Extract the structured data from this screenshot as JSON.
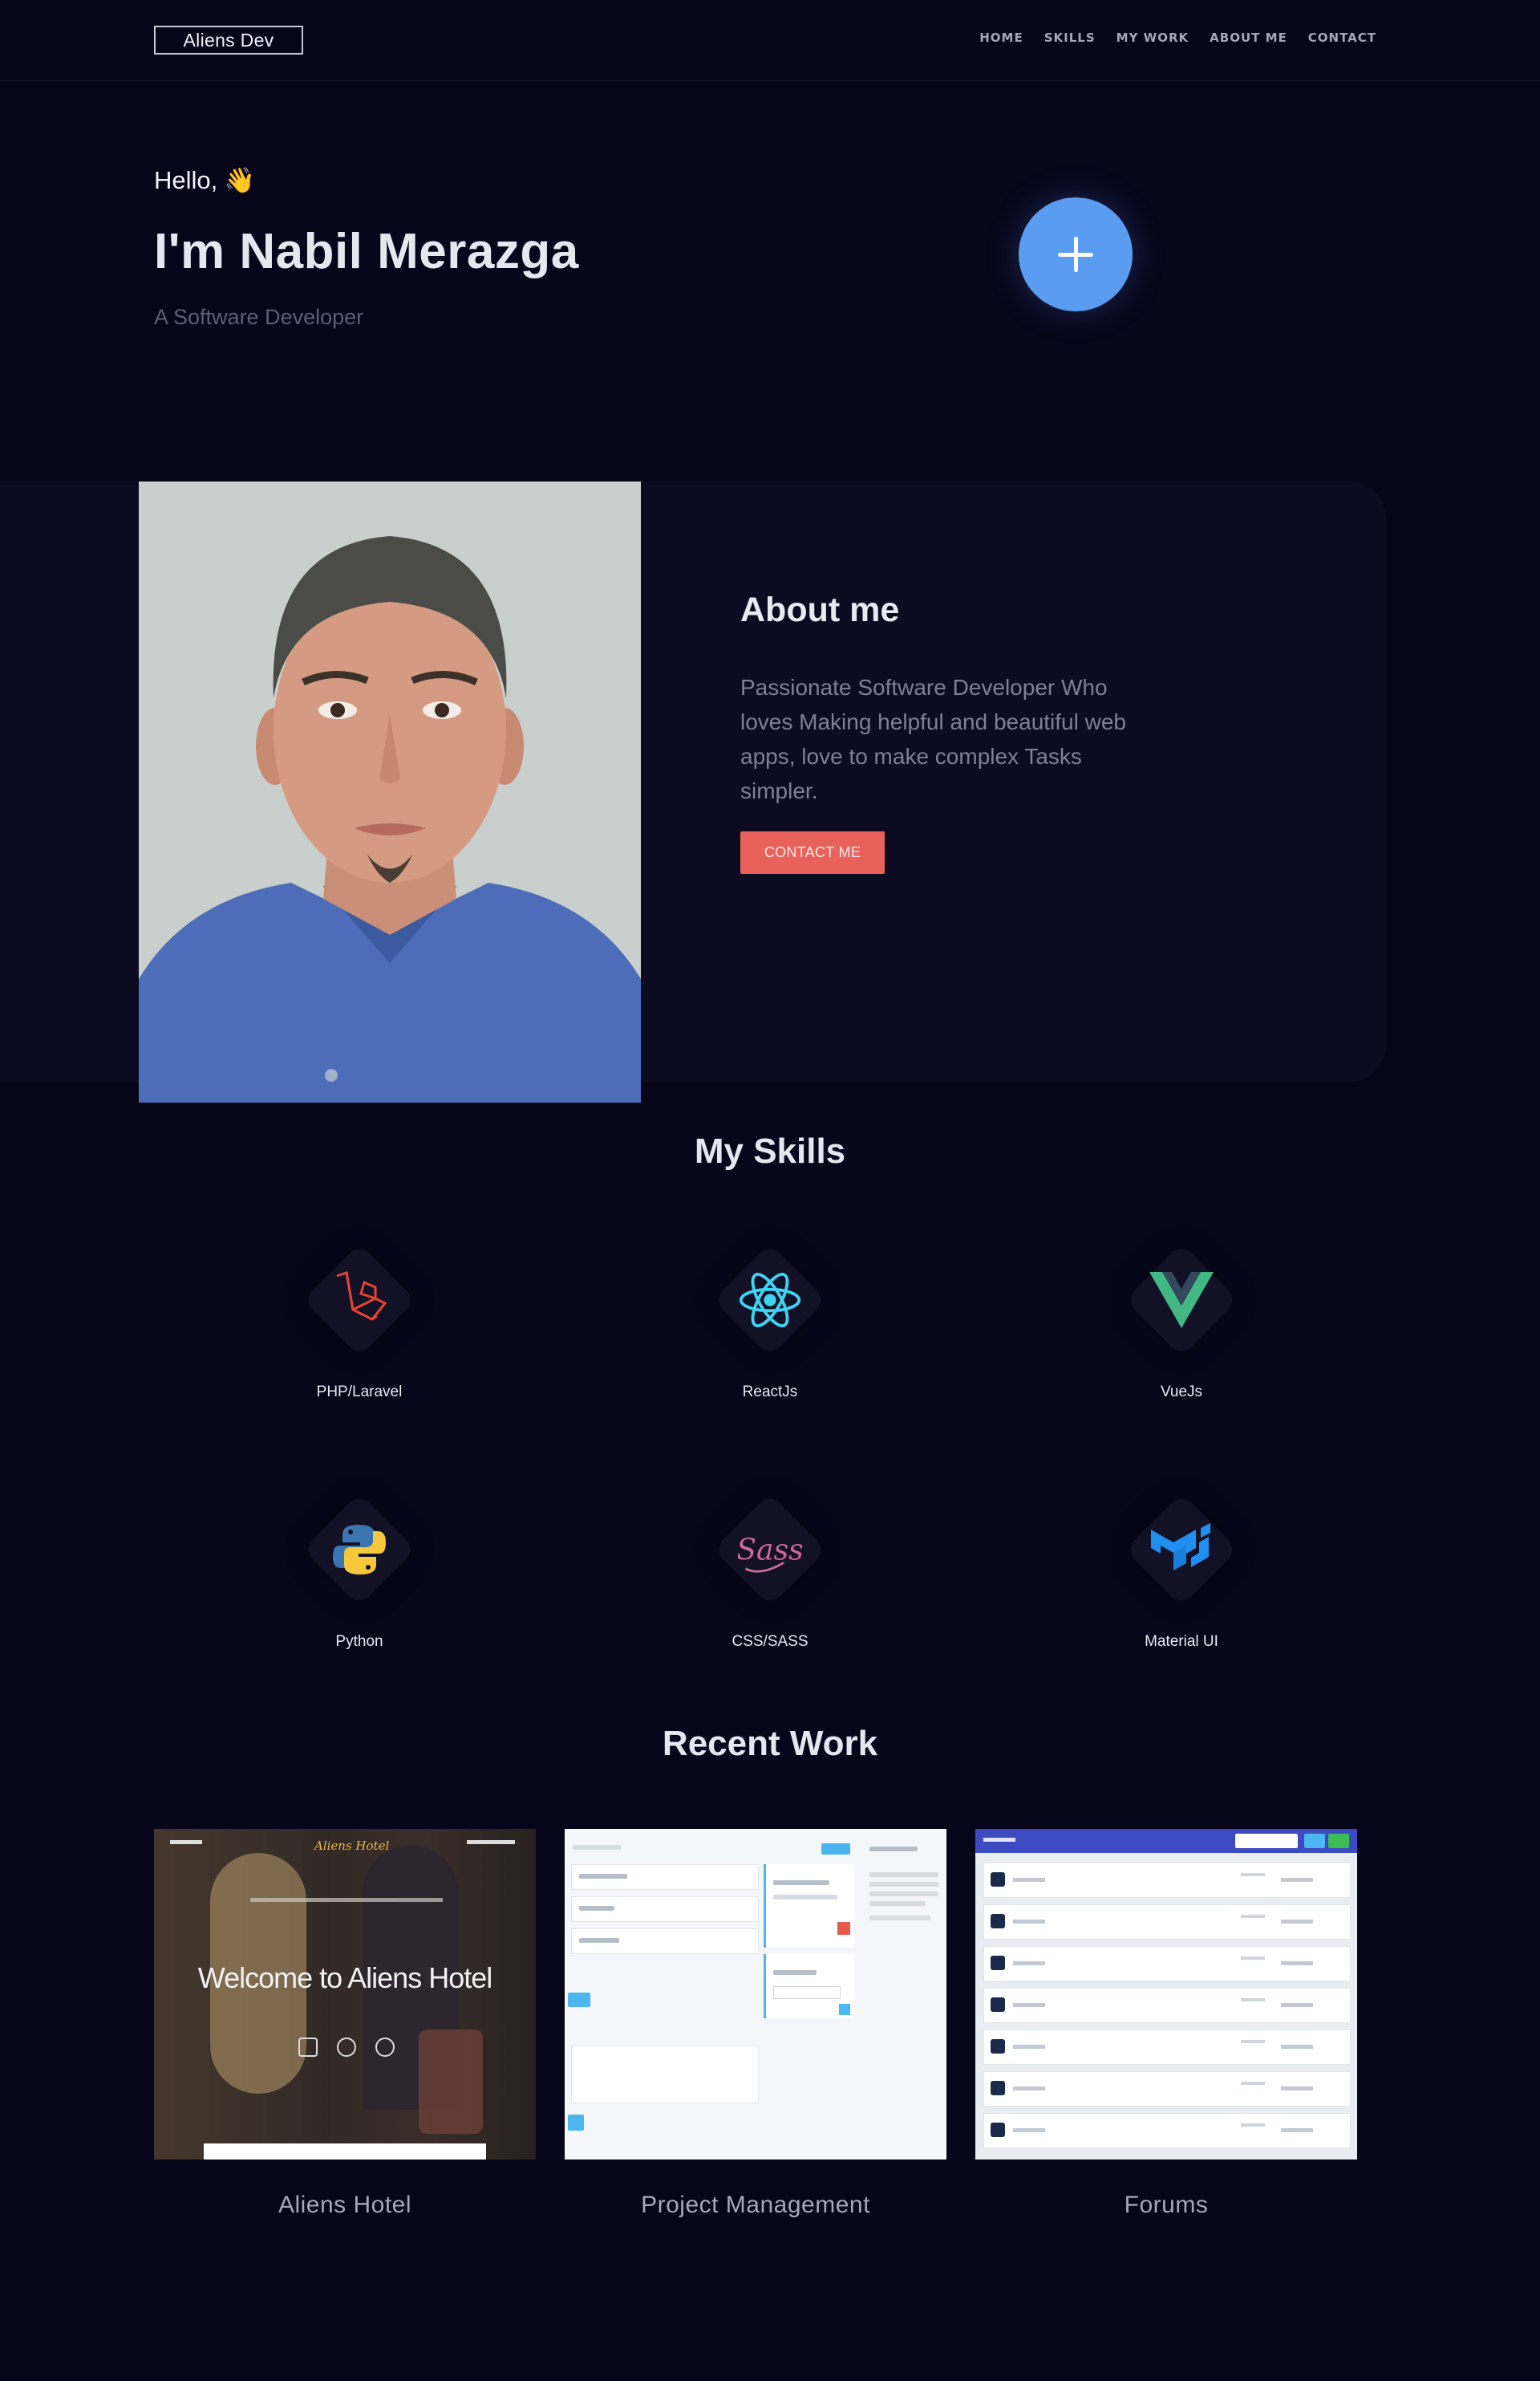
{
  "nav": {
    "brand": "Aliens Dev",
    "links": [
      "HOME",
      "SKILLS",
      "MY WORK",
      "ABOUT ME",
      "CONTACT"
    ]
  },
  "hero": {
    "greeting": "Hello, 👋",
    "name": "I'm Nabil Merazga",
    "role": "A Software Developer",
    "fab_icon": "plus-icon"
  },
  "about": {
    "title": "About me",
    "text": "Passionate Software Developer Who loves Making helpful and beautiful web apps, love to make complex Tasks simpler.",
    "button": "CONTACT ME"
  },
  "skills": {
    "title": "My Skills",
    "items": [
      {
        "label": "PHP/Laravel",
        "icon": "laravel-icon",
        "color": "#e74430"
      },
      {
        "label": "ReactJs",
        "icon": "react-icon",
        "color": "#3fd4f4"
      },
      {
        "label": "VueJs",
        "icon": "vue-icon",
        "color": "#41b883"
      },
      {
        "label": "Python",
        "icon": "python-icon",
        "color": "#f7c73c"
      },
      {
        "label": "CSS/SASS",
        "icon": "sass-icon",
        "color": "#cd6799"
      },
      {
        "label": "Material UI",
        "icon": "material-ui-icon",
        "color": "#1f8ff0"
      }
    ]
  },
  "work": {
    "title": "Recent Work",
    "items": [
      {
        "title": "Aliens Hotel",
        "thumb_text": "Welcome to Aliens Hotel"
      },
      {
        "title": "Project Management",
        "thumb_text": ""
      },
      {
        "title": "Forums",
        "thumb_text": ""
      }
    ]
  },
  "colors": {
    "background": "#07051a",
    "accent_button": "#e8615a",
    "fab": "#5a9cf0"
  }
}
